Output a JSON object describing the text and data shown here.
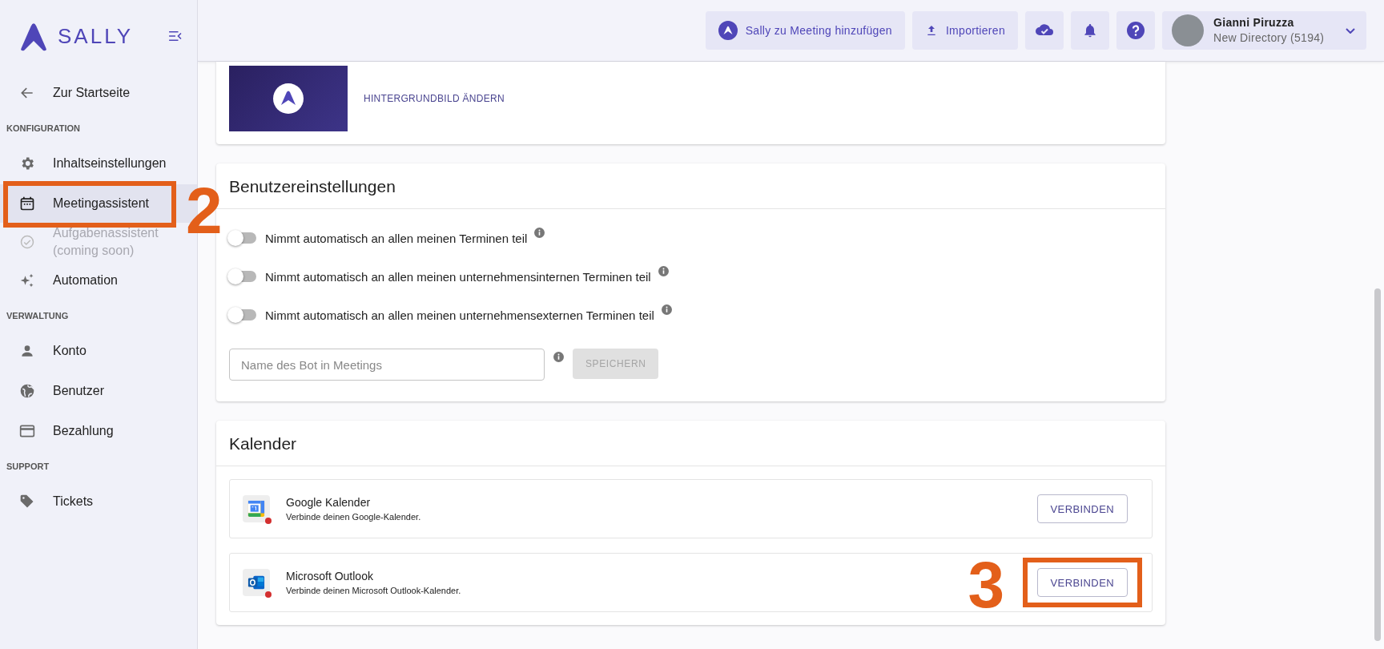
{
  "sidebar": {
    "logo": "SALLY",
    "back": "Zur Startseite",
    "sections": [
      {
        "heading": "KONFIGURATION",
        "items": [
          {
            "label": "Inhaltseinstellungen",
            "selected": false,
            "disabled": false
          },
          {
            "label": "Meetingassistent",
            "selected": true,
            "disabled": false,
            "annotation": "2"
          },
          {
            "label": "Aufgabenassistent",
            "sublabel": "(coming soon)",
            "selected": false,
            "disabled": true
          },
          {
            "label": "Automation",
            "selected": false,
            "disabled": false
          }
        ]
      },
      {
        "heading": "VERWALTUNG",
        "items": [
          {
            "label": "Konto",
            "selected": false,
            "disabled": false
          },
          {
            "label": "Benutzer",
            "selected": false,
            "disabled": false
          },
          {
            "label": "Bezahlung",
            "selected": false,
            "disabled": false
          }
        ]
      },
      {
        "heading": "SUPPORT",
        "items": [
          {
            "label": "Tickets",
            "selected": false,
            "disabled": false
          }
        ]
      }
    ]
  },
  "header": {
    "buttons": [
      {
        "label": "Sally zu Meeting hinzufügen"
      },
      {
        "label": "Importieren"
      }
    ],
    "user": {
      "name": "Gianni Piruzza",
      "directory": "New Directory (5194)"
    }
  },
  "background": {
    "action": "HINTERGRUNDBILD ÄNDERN"
  },
  "user_settings": {
    "title": "Benutzereinstellungen",
    "toggles": [
      {
        "label": "Nimmt automatisch an allen meinen Terminen teil",
        "on": false
      },
      {
        "label": "Nimmt automatisch an allen meinen unternehmensinternen Terminen teil",
        "on": false
      },
      {
        "label": "Nimmt automatisch an allen meinen unternehmensexternen Terminen teil",
        "on": false
      }
    ],
    "bot_name": {
      "placeholder": "Name des Bot in Meetings"
    },
    "save": {
      "label": "SPEICHERN",
      "disabled": true
    }
  },
  "calendar": {
    "title": "Kalender",
    "providers": [
      {
        "name": "Google Kalender",
        "description": "Verbinde deinen Google-Kalender.",
        "connected": false,
        "button": "VERBINDEN"
      },
      {
        "name": "Microsoft Outlook",
        "description": "Verbinde deinen Microsoft Outlook-Kalender.",
        "connected": false,
        "button": "VERBINDEN",
        "annotation": "3"
      }
    ]
  }
}
